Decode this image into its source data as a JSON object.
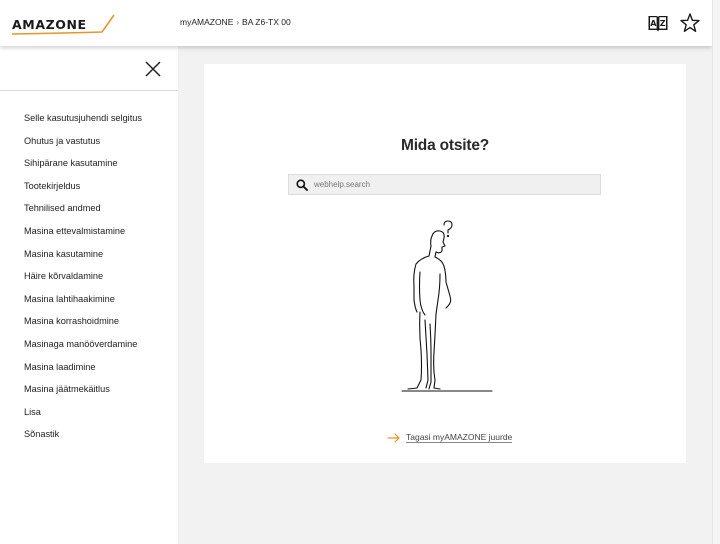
{
  "header": {
    "logo_text": "AMAZONE",
    "breadcrumb": [
      "myAMAZONE",
      "BA Z6-TX 00"
    ],
    "icons": [
      "glossary-book-icon",
      "favorite-star-icon"
    ]
  },
  "sidebar": {
    "items": [
      {
        "label": "Selle kasutusjuhendi selgitus"
      },
      {
        "label": "Ohutus ja vastutus"
      },
      {
        "label": "Sihipärane kasutamine"
      },
      {
        "label": "Tootekirjeldus"
      },
      {
        "label": "Tehnilised andmed"
      },
      {
        "label": "Masina ettevalmistamine"
      },
      {
        "label": "Masina kasutamine"
      },
      {
        "label": "Häire kõrvaldamine"
      },
      {
        "label": "Masina lahtihaakimine"
      },
      {
        "label": "Masina korrashoidmine"
      },
      {
        "label": "Masinaga manööverdamine"
      },
      {
        "label": "Masina laadimine"
      },
      {
        "label": "Masina jäätmekäitlus"
      },
      {
        "label": "Lisa"
      },
      {
        "label": "Sõnastik"
      }
    ]
  },
  "main": {
    "title": "Mida otsite?",
    "search_placeholder": "webhelp.search",
    "back_link": "Tagasi myAMAZONE juurde"
  },
  "colors": {
    "accent": "#e8942a",
    "text": "#222222",
    "background": "#f2f2f2"
  }
}
